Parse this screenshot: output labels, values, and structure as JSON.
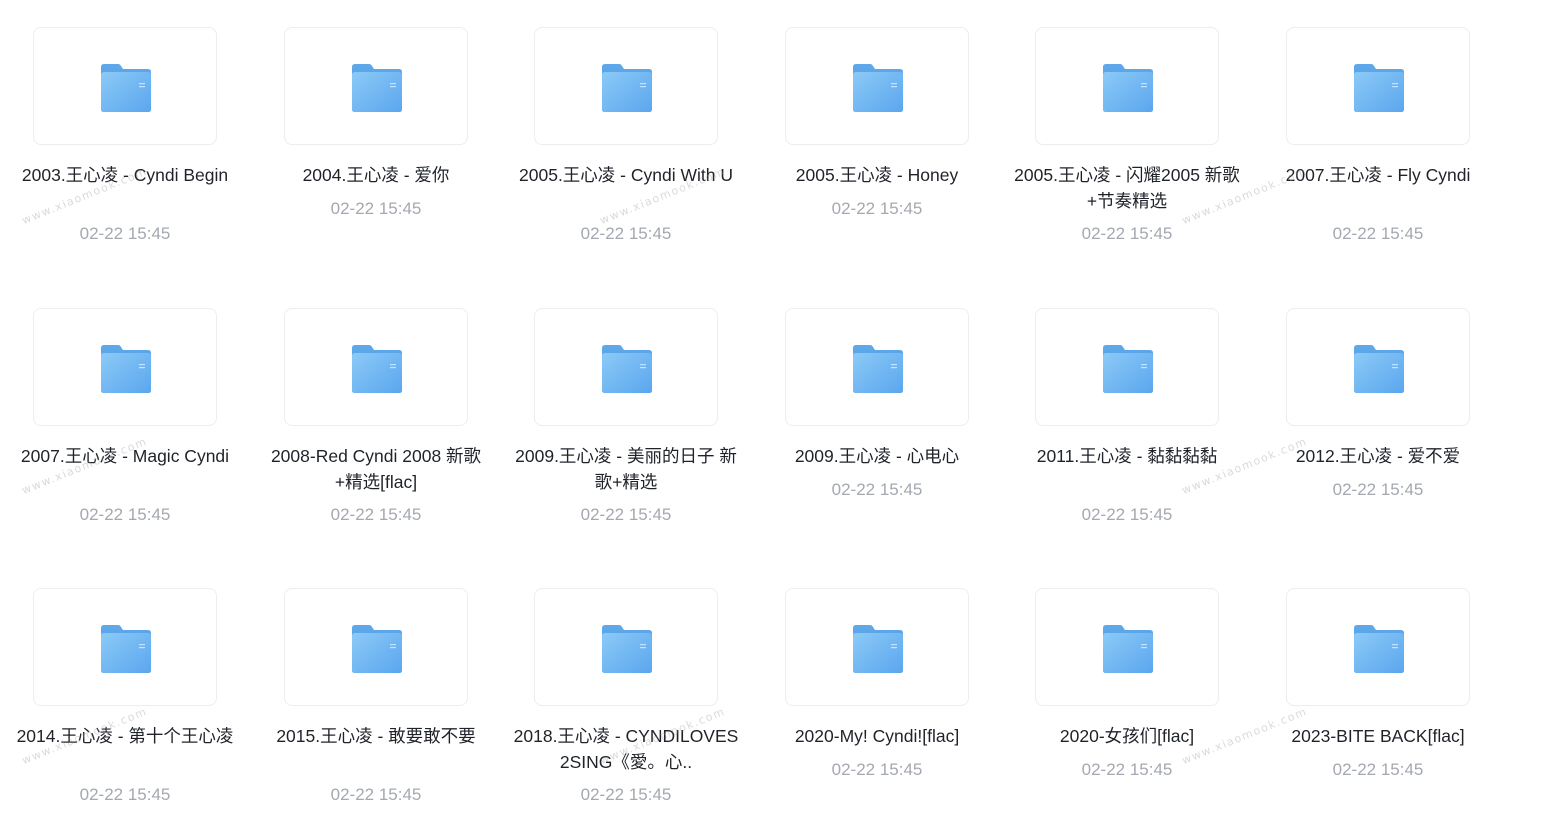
{
  "watermark_text": "www.xiaomook.com",
  "folder_color": "#7cbdf3",
  "items": [
    {
      "name": "2003.王心凌 - Cyndi Begin",
      "date": "02-22 15:45",
      "lines": 2
    },
    {
      "name": "2004.王心凌 - 爱你",
      "date": "02-22 15:45",
      "lines": 1
    },
    {
      "name": "2005.王心凌 - Cyndi With U",
      "date": "02-22 15:45",
      "lines": 2
    },
    {
      "name": "2005.王心凌 - Honey",
      "date": "02-22 15:45",
      "lines": 1
    },
    {
      "name": "2005.王心凌 - 闪耀2005 新歌+节奏精选",
      "date": "02-22 15:45",
      "lines": 2
    },
    {
      "name": "2007.王心凌 - Fly Cyndi",
      "date": "02-22 15:45",
      "lines": 2
    },
    {
      "name": "2007.王心凌 - Magic Cyndi",
      "date": "02-22 15:45",
      "lines": 2
    },
    {
      "name": "2008-Red Cyndi 2008 新歌+精选[flac]",
      "date": "02-22 15:45",
      "lines": 2
    },
    {
      "name": "2009.王心凌 - 美丽的日子 新歌+精选",
      "date": "02-22 15:45",
      "lines": 2
    },
    {
      "name": "2009.王心凌 - 心电心",
      "date": "02-22 15:45",
      "lines": 1
    },
    {
      "name": "2011.王心凌 - 黏黏黏黏",
      "date": "02-22 15:45",
      "lines": 2
    },
    {
      "name": "2012.王心凌 - 爱不爱",
      "date": "02-22 15:45",
      "lines": 1
    },
    {
      "name": "2014.王心凌 - 第十个王心凌",
      "date": "02-22 15:45",
      "lines": 2
    },
    {
      "name": "2015.王心凌 - 敢要敢不要",
      "date": "02-22 15:45",
      "lines": 2
    },
    {
      "name": "2018.王心凌 - CYNDILOVES2SING《愛。心..",
      "date": "02-22 15:45",
      "lines": 2
    },
    {
      "name": "2020-My! Cyndi![flac]",
      "date": "02-22 15:45",
      "lines": 1
    },
    {
      "name": "2020-女孩们[flac]",
      "date": "02-22 15:45",
      "lines": 1
    },
    {
      "name": "2023-BITE BACK[flac]",
      "date": "02-22 15:45",
      "lines": 1
    }
  ]
}
